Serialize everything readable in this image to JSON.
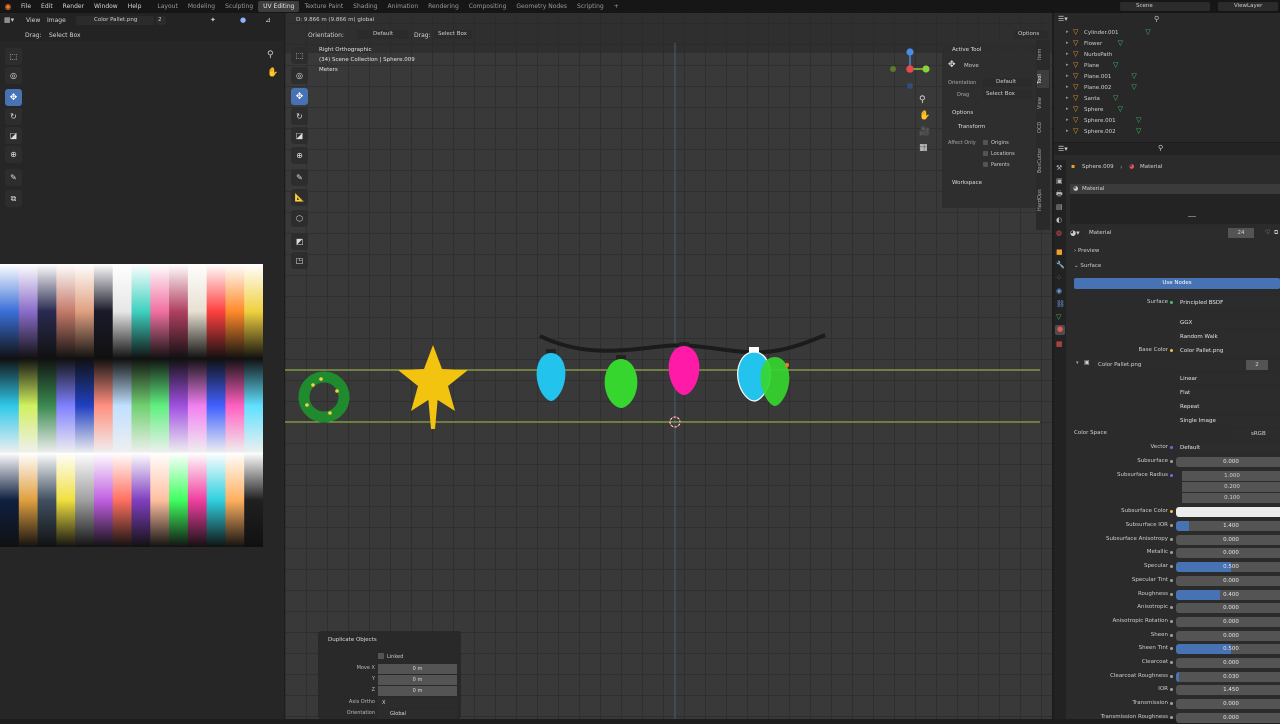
{
  "menubar": {
    "menus": [
      "File",
      "Edit",
      "Render",
      "Window",
      "Help"
    ],
    "workspaces": [
      "Layout",
      "Modeling",
      "Sculpting",
      "UV Editing",
      "Texture Paint",
      "Shading",
      "Animation",
      "Rendering",
      "Compositing",
      "Geometry Nodes",
      "Scripting"
    ],
    "active_workspace": "UV Editing",
    "scene": "Scene",
    "view_layer": "ViewLayer"
  },
  "uv_editor": {
    "menus": [
      "View",
      "Image"
    ],
    "image_name": "Color Pallet.png",
    "users": "2",
    "drag_label": "Drag:",
    "drag_value": "Select Box"
  },
  "viewport": {
    "orientation_label": "Orientation:",
    "orientation_value": "Default",
    "drag_label": "Drag:",
    "drag_value": "Select Box",
    "options_label": "Options",
    "status_line": "D: 9.866 m (9.866 m) global",
    "view_name": "Right Orthographic",
    "collection_line": "(34) Scene Collection | Sphere.009",
    "units": "Meters"
  },
  "npanel": {
    "active_tool_title": "Active Tool",
    "tool_name": "Move",
    "orientation_label": "Orientation",
    "orientation_value": "Default",
    "drag_label": "Drag",
    "drag_value": "Select Box",
    "options_title": "Options",
    "transform_title": "Transform",
    "affect_only_label": "Affect Only",
    "affect_items": [
      "Origins",
      "Locations",
      "Parents"
    ],
    "workspace_title": "Workspace",
    "tabs": [
      "Item",
      "Tool",
      "View",
      "OCD",
      "BoxCutter",
      "HardOps"
    ]
  },
  "outliner": {
    "items": [
      {
        "name": "Cylinder.001",
        "mod": true
      },
      {
        "name": "Flower",
        "mod": true
      },
      {
        "name": "NurbsPath",
        "mod": false
      },
      {
        "name": "Plane",
        "mod": true
      },
      {
        "name": "Plane.001",
        "mod": true
      },
      {
        "name": "Plane.002",
        "mod": true
      },
      {
        "name": "Santa",
        "mod": true
      },
      {
        "name": "Sphere",
        "mod": true
      },
      {
        "name": "Sphere.001",
        "mod": true
      },
      {
        "name": "Sphere.002",
        "mod": true
      }
    ]
  },
  "properties": {
    "breadcrumb_object": "Sphere.009",
    "breadcrumb_material": "Material",
    "slot_name": "Material",
    "material_name": "Material",
    "material_users": "24",
    "preview_label": "Preview",
    "surface_label": "Surface",
    "use_nodes_label": "Use Nodes",
    "surface_shader": "Principled BSDF",
    "distribution": "GGX",
    "subsurface_method": "Random Walk",
    "base_color_label": "Base Color",
    "base_color_value": "Color Pallet.png",
    "image_name": "Color Pallet.png",
    "image_users": "2",
    "interpolation": "Linear",
    "projection": "Flat",
    "extension": "Repeat",
    "source": "Single Image",
    "color_space_label": "Color Space",
    "color_space_value": "sRGB",
    "vector_label": "Vector",
    "vector_value": "Default",
    "subsurface_label": "Subsurface",
    "subsurface_value": "0.000",
    "subsurface_radius_label": "Subsurface Radius",
    "subsurface_radius": [
      "1.000",
      "0.200",
      "0.100"
    ],
    "subsurface_color_label": "Subsurface Color",
    "params": [
      {
        "label": "Subsurface IOR",
        "value": "1.400",
        "fill": 0.12
      },
      {
        "label": "Subsurface Anisotropy",
        "value": "0.000",
        "fill": 0
      },
      {
        "label": "Metallic",
        "value": "0.000",
        "fill": 0
      },
      {
        "label": "Specular",
        "value": "0.500",
        "fill": 0.5
      },
      {
        "label": "Specular Tint",
        "value": "0.000",
        "fill": 0
      },
      {
        "label": "Roughness",
        "value": "0.400",
        "fill": 0.4
      },
      {
        "label": "Anisotropic",
        "value": "0.000",
        "fill": 0
      },
      {
        "label": "Anisotropic Rotation",
        "value": "0.000",
        "fill": 0
      },
      {
        "label": "Sheen",
        "value": "0.000",
        "fill": 0
      },
      {
        "label": "Sheen Tint",
        "value": "0.500",
        "fill": 0.5
      },
      {
        "label": "Clearcoat",
        "value": "0.000",
        "fill": 0
      },
      {
        "label": "Clearcoat Roughness",
        "value": "0.030",
        "fill": 0.03
      },
      {
        "label": "IOR",
        "value": "1.450",
        "fill": 0
      },
      {
        "label": "Transmission",
        "value": "0.000",
        "fill": 0
      },
      {
        "label": "Transmission Roughness",
        "value": "0.000",
        "fill": 0
      }
    ]
  },
  "duplicate_panel": {
    "title": "Duplicate Objects",
    "linked_label": "Linked",
    "move_x_label": "Move X",
    "move_x": "0 m",
    "y_label": "Y",
    "y": "0 m",
    "z_label": "Z",
    "z": "0 m",
    "axis_ortho_label": "Axis Ortho",
    "axis_ortho_value": "X",
    "orientation_label": "Orientation",
    "orientation_value": "Global"
  },
  "colors": {
    "accent": "#4772b3",
    "viewport_bg": "#393939",
    "panel_bg": "#2b2b2b",
    "wreath": "#1f8a2e",
    "star": "#f2c40f",
    "bulb_cyan": "#22c4ee",
    "bulb_green": "#36d62f",
    "bulb_magenta": "#ff1aa8"
  }
}
